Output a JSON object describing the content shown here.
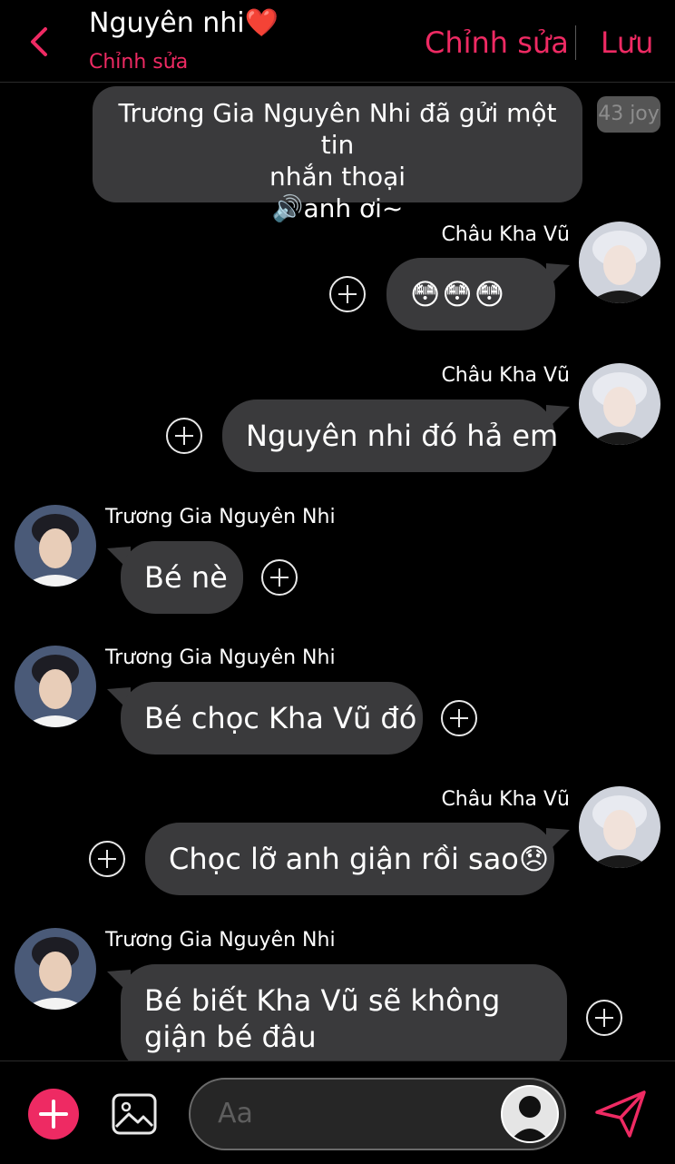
{
  "header": {
    "title": "Nguyên nhi❤️",
    "subtitle": "Chỉnh sửa",
    "edit_label": "Chỉnh sửa",
    "save_label": "Lưu"
  },
  "system_message": {
    "line1": "Trương Gia Nguyên Nhi đã gửi một tin",
    "line2": "nhắn thoại",
    "line3": "🔊anh ơi~",
    "badge": "43 joy"
  },
  "messages": [
    {
      "sender": "Châu Kha Vũ",
      "text": "😳😳😳"
    },
    {
      "sender": "Châu Kha Vũ",
      "text": "Nguyên nhi đó hả em"
    },
    {
      "sender": "Trương Gia Nguyên Nhi",
      "text": "Bé nè"
    },
    {
      "sender": "Trương Gia Nguyên Nhi",
      "text": "Bé chọc Kha Vũ đó"
    },
    {
      "sender": "Châu Kha Vũ",
      "text": "Chọc lỡ anh giận rồi sao😞"
    },
    {
      "sender": "Trương Gia Nguyên Nhi",
      "text": "Bé biết Kha Vũ sẽ không giận bé đâu"
    }
  ],
  "composer": {
    "placeholder": "Aa"
  },
  "colors": {
    "accent": "#ee2a63",
    "bubble": "#3a3a3c",
    "background": "#000000"
  },
  "icons": [
    "chevron-left-icon",
    "add-circle-icon",
    "image-icon",
    "send-icon",
    "voice-icon"
  ]
}
